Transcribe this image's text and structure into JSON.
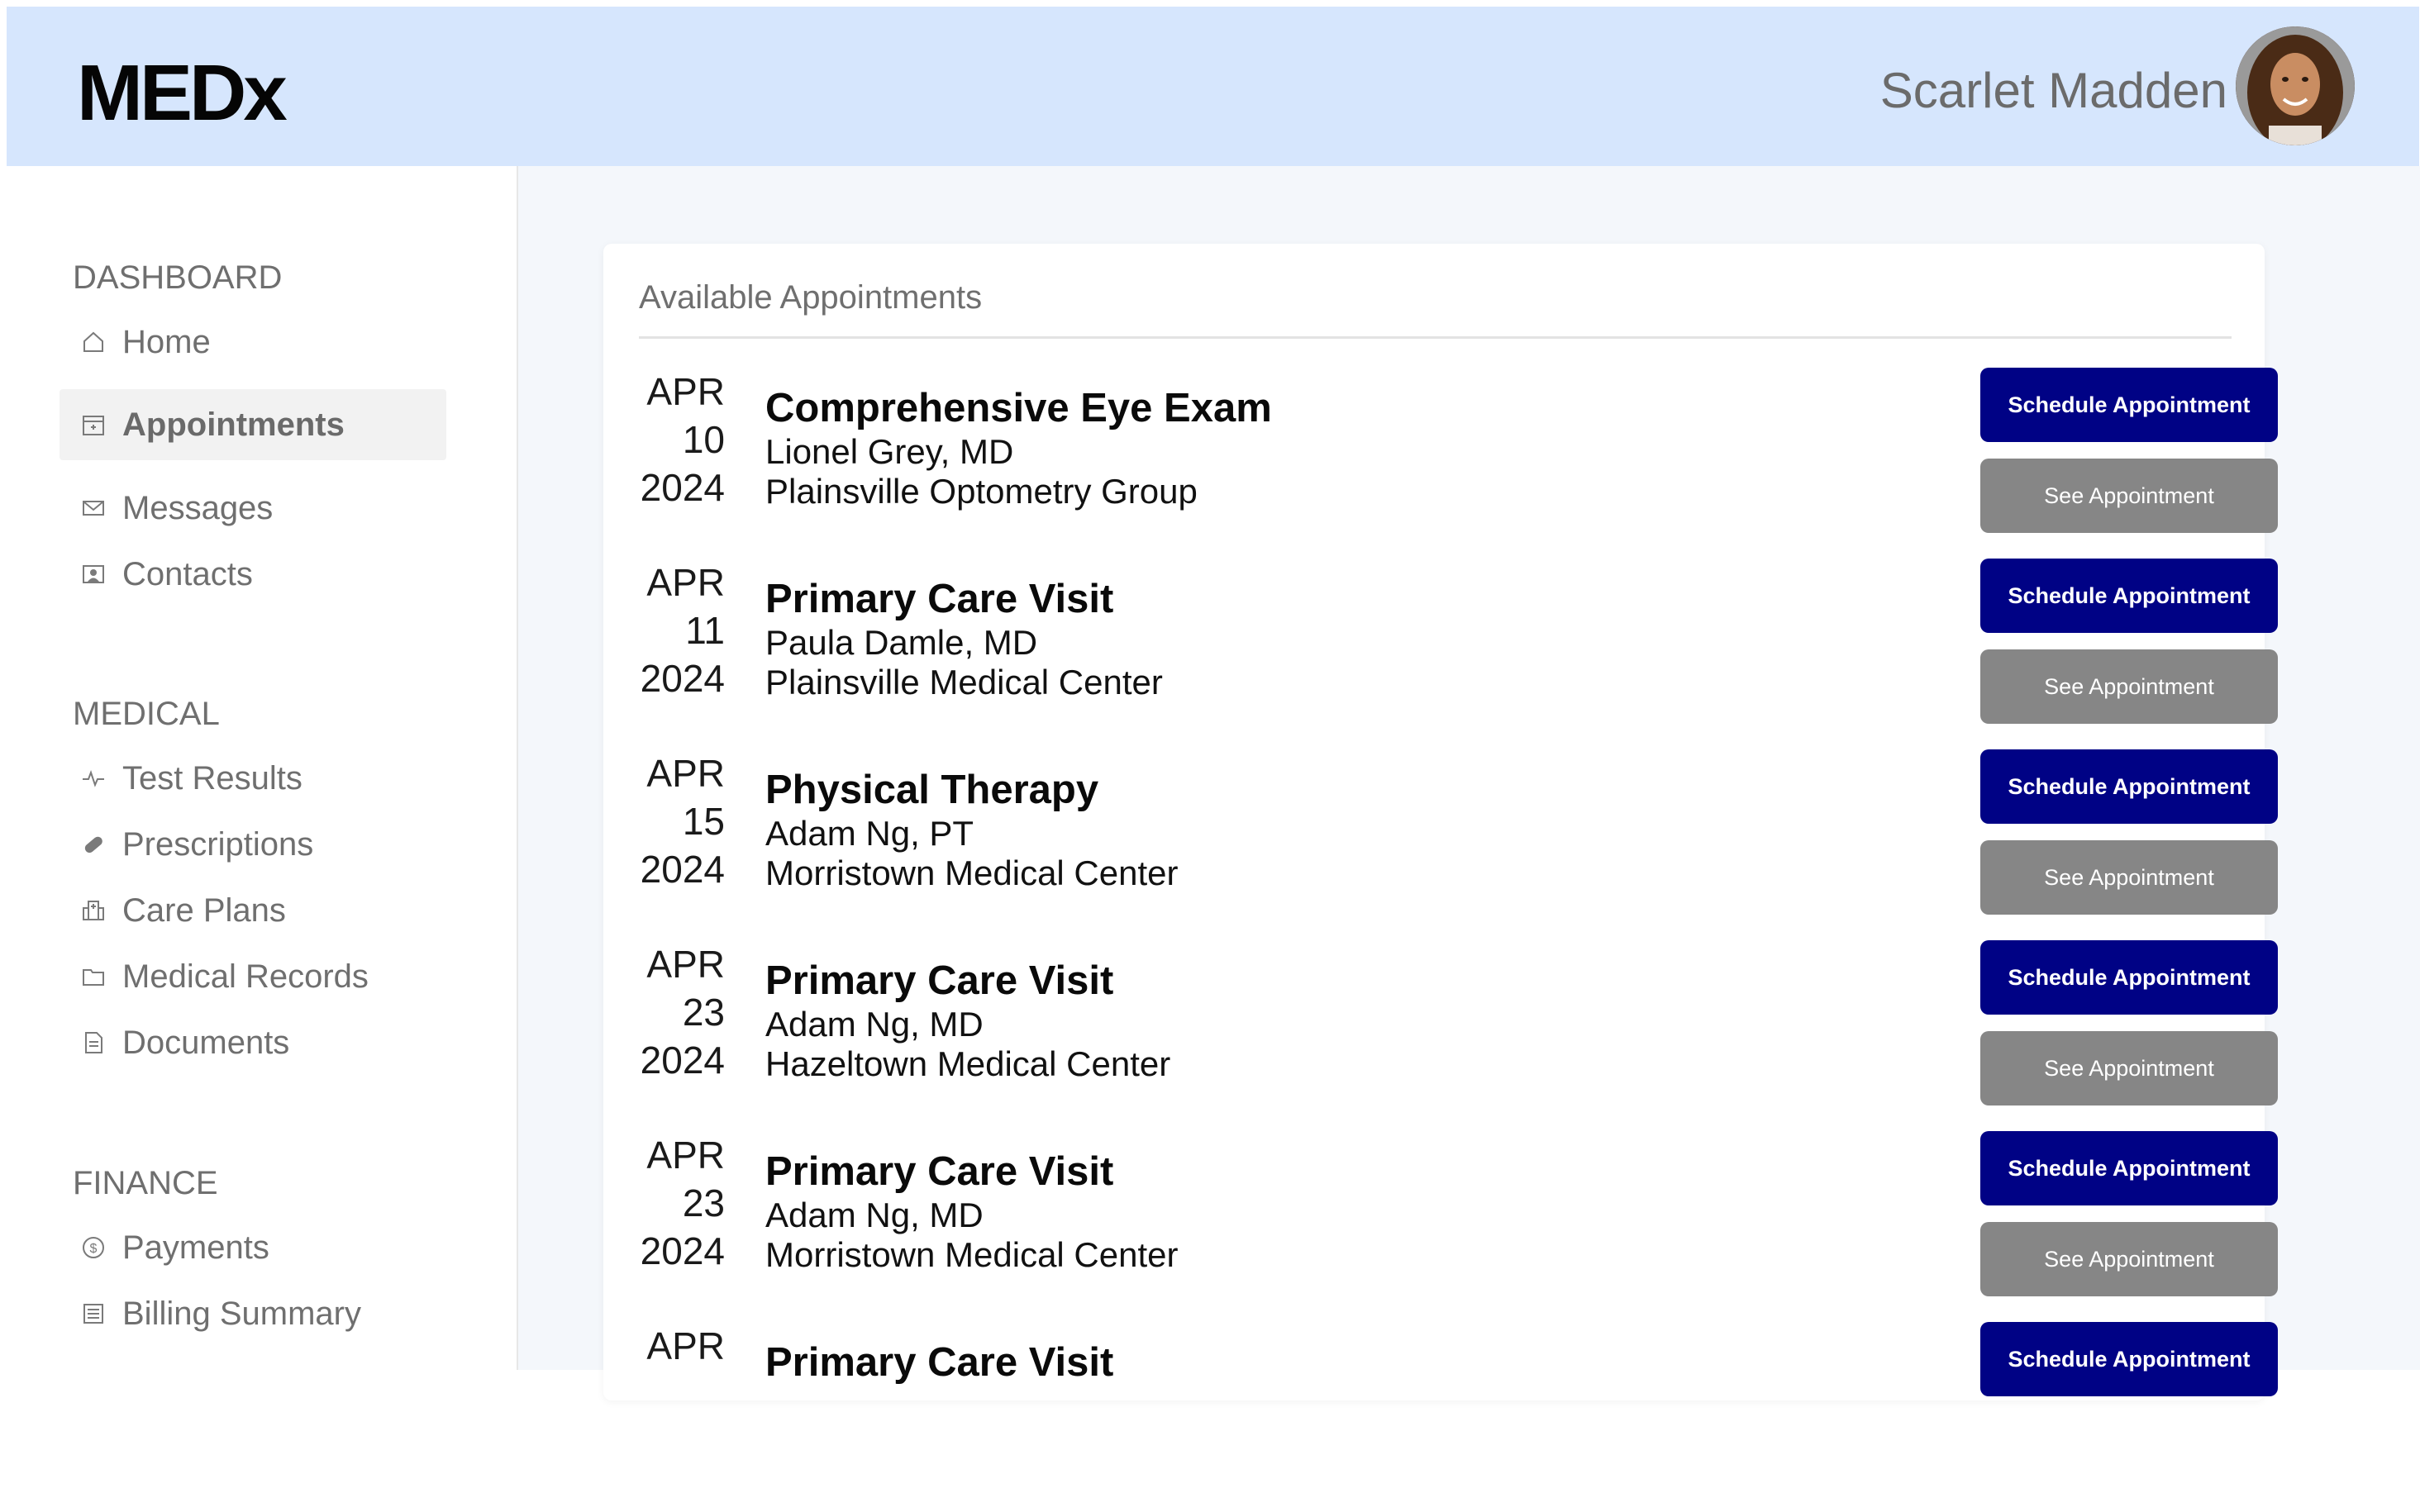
{
  "app": {
    "logo": "MEDx",
    "user_name": "Scarlet Madden"
  },
  "sidebar": {
    "sections": [
      {
        "title": "DASHBOARD",
        "items": [
          {
            "label": "Home",
            "icon": "home-icon"
          },
          {
            "label": "Appointments",
            "icon": "calendar-icon",
            "active": true
          },
          {
            "label": "Messages",
            "icon": "envelope-icon"
          },
          {
            "label": "Contacts",
            "icon": "contact-card-icon"
          }
        ]
      },
      {
        "title": "MEDICAL",
        "items": [
          {
            "label": "Test Results",
            "icon": "pulse-icon"
          },
          {
            "label": "Prescriptions",
            "icon": "pill-icon"
          },
          {
            "label": "Care Plans",
            "icon": "hospital-icon"
          },
          {
            "label": "Medical Records",
            "icon": "folder-icon"
          },
          {
            "label": "Documents",
            "icon": "document-icon"
          }
        ]
      },
      {
        "title": "FINANCE",
        "items": [
          {
            "label": "Payments",
            "icon": "dollar-coin-icon"
          },
          {
            "label": "Billing Summary",
            "icon": "receipt-icon"
          }
        ]
      }
    ]
  },
  "main": {
    "card_title": "Available Appointments",
    "appointments": [
      {
        "month": "APR",
        "day": "10",
        "year": "2024",
        "title": "Comprehensive Eye Exam",
        "doctor": "Lionel Grey, MD",
        "location": "Plainsville Optometry Group"
      },
      {
        "month": "APR",
        "day": "11",
        "year": "2024",
        "title": "Primary Care Visit",
        "doctor": "Paula Damle, MD",
        "location": "Plainsville Medical Center"
      },
      {
        "month": "APR",
        "day": "15",
        "year": "2024",
        "title": "Physical Therapy",
        "doctor": "Adam Ng, PT",
        "location": "Morristown Medical Center"
      },
      {
        "month": "APR",
        "day": "23",
        "year": "2024",
        "title": "Primary Care Visit",
        "doctor": "Adam Ng, MD",
        "location": "Hazeltown Medical Center"
      },
      {
        "month": "APR",
        "day": "23",
        "year": "2024",
        "title": "Primary Care Visit",
        "doctor": "Adam Ng, MD",
        "location": "Morristown Medical Center"
      },
      {
        "month": "APR",
        "day": "",
        "year": "",
        "title": "Primary Care Visit",
        "doctor": "",
        "location": ""
      }
    ],
    "schedule_label": "Schedule Appointment",
    "see_label": "See Appointment"
  },
  "colors": {
    "header_bg": "#d6e6fd",
    "primary_button": "#000285",
    "secondary_button": "#868686",
    "main_bg": "#f4f7fb"
  }
}
